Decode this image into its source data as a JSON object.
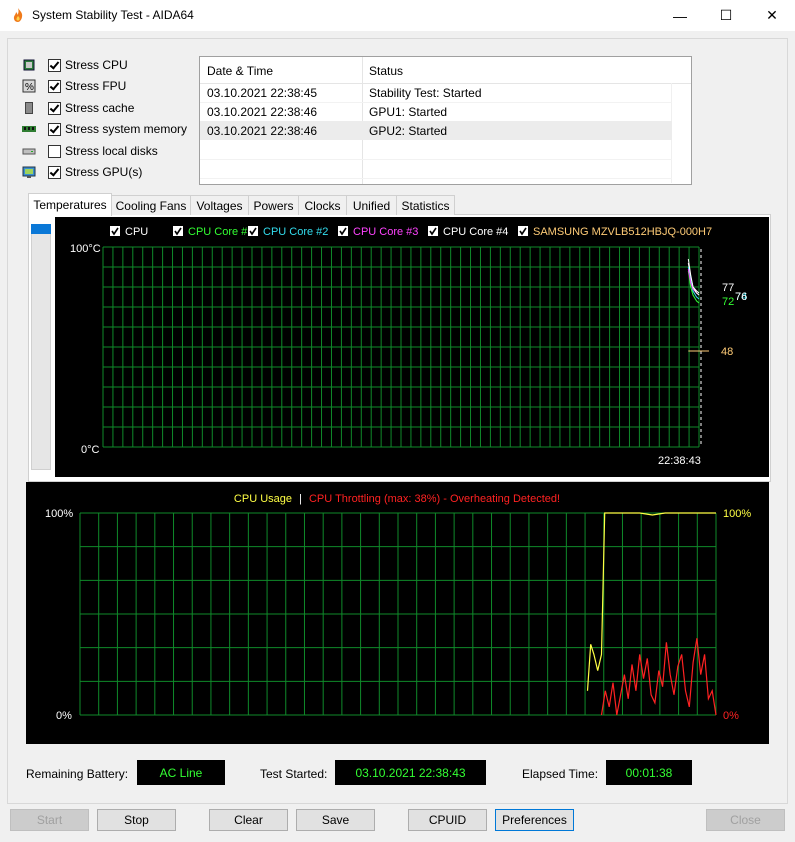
{
  "window": {
    "title": "System Stability Test - AIDA64",
    "minimize_glyph": "—",
    "maximize_glyph": "☐",
    "close_glyph": "✕",
    "icon": "flame-icon"
  },
  "stress_options": [
    {
      "label": "Stress CPU",
      "checked": true,
      "icon": "cpu-icon"
    },
    {
      "label": "Stress FPU",
      "checked": true,
      "icon": "fpu-icon"
    },
    {
      "label": "Stress cache",
      "checked": true,
      "icon": "cache-icon"
    },
    {
      "label": "Stress system memory",
      "checked": true,
      "icon": "memory-icon"
    },
    {
      "label": "Stress local disks",
      "checked": false,
      "icon": "disk-icon"
    },
    {
      "label": "Stress GPU(s)",
      "checked": true,
      "icon": "gpu-icon"
    }
  ],
  "log": {
    "columns": [
      "Date & Time",
      "Status"
    ],
    "rows": [
      {
        "time": "03.10.2021 22:38:45",
        "status": "Stability Test: Started"
      },
      {
        "time": "03.10.2021 22:38:46",
        "status": "GPU1: Started"
      },
      {
        "time": "03.10.2021 22:38:46",
        "status": "GPU2: Started",
        "selected": true
      }
    ]
  },
  "tabs": [
    "Temperatures",
    "Cooling Fans",
    "Voltages",
    "Powers",
    "Clocks",
    "Unified",
    "Statistics"
  ],
  "active_tab": "Temperatures",
  "temp_chart": {
    "legend": [
      {
        "label": "CPU",
        "color": "#ffffff",
        "checked": true
      },
      {
        "label": "CPU Core #1",
        "color": "#33ff33",
        "checked": true
      },
      {
        "label": "CPU Core #2",
        "color": "#33ddee",
        "checked": true
      },
      {
        "label": "CPU Core #3",
        "color": "#ff44ff",
        "checked": true
      },
      {
        "label": "CPU Core #4",
        "color": "#ffffff",
        "checked": true
      },
      {
        "label": "SAMSUNG MZVLB512HBJQ-000H7",
        "color": "#ffcc77",
        "checked": true
      }
    ],
    "y_max_label": "100°C",
    "y_min_label": "0°C",
    "time_label": "22:38:43",
    "value_labels": [
      {
        "text": "77",
        "color": "#ffffff"
      },
      {
        "text": "72",
        "color": "#33ff33"
      },
      {
        "text": "74",
        "color": "#33ddee"
      },
      {
        "text": "76",
        "color": "#ffffff"
      },
      {
        "text": "48",
        "color": "#ffcc77"
      }
    ]
  },
  "usage_chart": {
    "title_usage": "CPU Usage",
    "title_sep": "|",
    "title_throttle": "CPU Throttling (max: 38%) - Overheating Detected!",
    "usage_color": "#ffff44",
    "throttle_color": "#ff2222",
    "y_max_left": "100%",
    "y_min_left": "0%",
    "y_max_right": "100%",
    "y_min_right": "0%"
  },
  "status": {
    "battery_label": "Remaining Battery:",
    "battery_value": "AC Line",
    "started_label": "Test Started:",
    "started_value": "03.10.2021 22:38:43",
    "elapsed_label": "Elapsed Time:",
    "elapsed_value": "00:01:38"
  },
  "buttons": {
    "start": "Start",
    "stop": "Stop",
    "clear": "Clear",
    "save": "Save",
    "cpuid": "CPUID",
    "preferences": "Preferences",
    "close": "Close"
  },
  "chart_data": [
    {
      "type": "line",
      "x_range": [
        0,
        100
      ],
      "ylim": [
        0,
        100
      ],
      "grid": true,
      "series": [
        {
          "name": "CPU",
          "color": "#ffffff",
          "x": [
            98.2,
            98.6,
            99.0,
            99.6,
            100
          ],
          "values": [
            92,
            85,
            80,
            78,
            77
          ]
        },
        {
          "name": "CPU Core #1",
          "color": "#33ff33",
          "x": [
            98.2,
            98.6,
            99.0,
            99.6,
            100
          ],
          "values": [
            88,
            80,
            76,
            73,
            72
          ]
        },
        {
          "name": "CPU Core #2",
          "color": "#33ddee",
          "x": [
            98.2,
            98.6,
            99.0,
            99.6,
            100
          ],
          "values": [
            90,
            83,
            78,
            75,
            74
          ]
        },
        {
          "name": "CPU Core #3",
          "color": "#ff44ff",
          "x": [
            98.2,
            98.6,
            99.0,
            99.6,
            100
          ],
          "values": [
            89,
            82,
            79,
            77,
            76
          ]
        },
        {
          "name": "CPU Core #4",
          "color": "#ffffff",
          "x": [
            98.2,
            98.6,
            99.0,
            99.6,
            100
          ],
          "values": [
            94,
            86,
            80,
            77,
            76
          ]
        },
        {
          "name": "SAMSUNG MZVLB512HBJQ-000H7",
          "color": "#ffcc77",
          "x": [
            98.2,
            98.6,
            99.0,
            99.6,
            100
          ],
          "values": [
            48,
            48,
            48,
            48,
            48
          ]
        }
      ]
    },
    {
      "type": "line",
      "x_range": [
        0,
        100
      ],
      "ylim": [
        0,
        100
      ],
      "grid": true,
      "series": [
        {
          "name": "CPU Usage",
          "color": "#ffff44",
          "x": [
            79.8,
            80.3,
            80.8,
            81.4,
            82.0,
            82.5,
            83.2,
            84.0,
            88.0,
            90.0,
            92.0,
            100
          ],
          "values": [
            12,
            35,
            30,
            22,
            30,
            100,
            100,
            100,
            100,
            99,
            100,
            100
          ]
        },
        {
          "name": "CPU Throttling",
          "color": "#ff2222",
          "x": [
            82.0,
            82.6,
            83.2,
            83.8,
            84.4,
            85.0,
            85.6,
            86.2,
            86.8,
            87.4,
            88.0,
            88.6,
            89.2,
            89.8,
            90.4,
            91.0,
            91.6,
            92.2,
            92.8,
            93.4,
            94.0,
            94.6,
            95.2,
            95.8,
            96.4,
            97.0,
            97.6,
            98.2,
            98.8,
            99.4,
            100
          ],
          "values": [
            0,
            12,
            4,
            16,
            0,
            10,
            20,
            8,
            25,
            12,
            30,
            18,
            28,
            10,
            6,
            22,
            14,
            36,
            20,
            10,
            24,
            30,
            12,
            4,
            26,
            38,
            20,
            30,
            8,
            12,
            0
          ]
        }
      ]
    }
  ]
}
